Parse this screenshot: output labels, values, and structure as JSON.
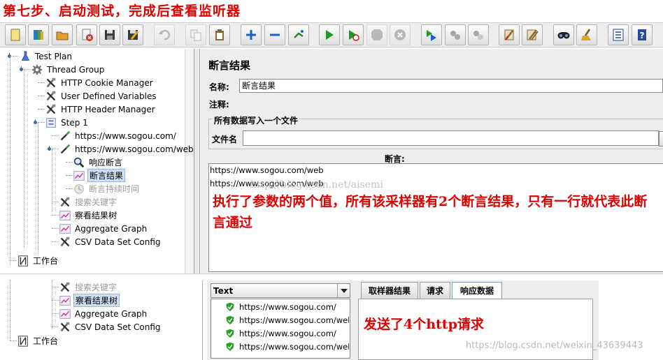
{
  "heading": "第七步、启动测试，完成后查看监听器",
  "toolbar": {
    "buttons": [
      {
        "icon": "new-icon",
        "color": "#f2e28a",
        "enabled": true
      },
      {
        "icon": "templates-icon",
        "color": "#4a9a4a",
        "enabled": true
      },
      {
        "icon": "open-icon",
        "color": "#e0a030",
        "enabled": true
      },
      {
        "icon": "close-plan-icon",
        "color": "#d03030",
        "enabled": true
      },
      {
        "icon": "save-icon",
        "color": "#3a3a3a",
        "enabled": true
      },
      {
        "icon": "save-as-icon",
        "color": "#3a3a3a",
        "enabled": true
      },
      {
        "icon": "undo-icon",
        "color": "#b8b8b8",
        "enabled": false
      },
      {
        "icon": "copy-icon",
        "color": "#b8b8b8",
        "enabled": false
      },
      {
        "icon": "paste-icon",
        "color": "#8a6a30",
        "enabled": true
      },
      {
        "icon": "expand-icon",
        "color": "#1a62c8",
        "enabled": true
      },
      {
        "icon": "collapse-icon",
        "color": "#1a62c8",
        "enabled": true
      },
      {
        "icon": "toggle-icon",
        "color": "#2a8a2a",
        "enabled": true
      },
      {
        "icon": "start-icon",
        "color": "#1f9a2a",
        "enabled": true
      },
      {
        "icon": "start-no-pause-icon",
        "color": "#1f9a2a",
        "enabled": true
      },
      {
        "icon": "stop-icon",
        "color": "#b8b8b8",
        "enabled": false
      },
      {
        "icon": "shutdown-icon",
        "color": "#b8b8b8",
        "enabled": false
      },
      {
        "icon": "remote-start-icon",
        "color": "#1f9a2a",
        "enabled": true
      },
      {
        "icon": "remote-stop-icon",
        "color": "#a8a8a8",
        "enabled": true
      },
      {
        "icon": "remote-shutdown-icon",
        "color": "#a8a8a8",
        "enabled": true
      },
      {
        "icon": "clear-icon",
        "color": "#8a6a30",
        "enabled": true
      },
      {
        "icon": "clear-all-icon",
        "color": "#8a6a30",
        "enabled": true
      },
      {
        "icon": "search-icon",
        "color": "#222222",
        "enabled": true
      },
      {
        "icon": "reset-search-icon",
        "color": "#d8a820",
        "enabled": true
      },
      {
        "icon": "function-helper-icon",
        "color": "#2a4a8a",
        "enabled": true
      },
      {
        "icon": "help-icon",
        "color": "#2a4a9a",
        "enabled": true
      }
    ]
  },
  "tree": {
    "nodes": [
      {
        "label": "Test Plan",
        "icon": "test-plan-icon",
        "selected": false,
        "disabled": false
      },
      {
        "label": "Thread Group",
        "icon": "thread-group-icon",
        "selected": false,
        "disabled": false
      },
      {
        "label": "HTTP Cookie Manager",
        "icon": "config-element-icon",
        "selected": false,
        "disabled": false
      },
      {
        "label": "User Defined Variables",
        "icon": "config-element-icon",
        "selected": false,
        "disabled": false
      },
      {
        "label": "HTTP Header Manager",
        "icon": "config-element-icon",
        "selected": false,
        "disabled": false
      },
      {
        "label": "Step 1",
        "icon": "controller-icon",
        "selected": false,
        "disabled": false
      },
      {
        "label": "https://www.sogou.com/",
        "icon": "sampler-icon",
        "selected": false,
        "disabled": false
      },
      {
        "label": "https://www.sogou.com/web",
        "icon": "sampler-icon",
        "selected": false,
        "disabled": false
      },
      {
        "label": "响应断言",
        "icon": "assertion-icon",
        "selected": false,
        "disabled": false
      },
      {
        "label": "断言结果",
        "icon": "listener-icon",
        "selected": true,
        "disabled": false
      },
      {
        "label": "断言持续时间",
        "icon": "duration-assertion-icon",
        "selected": false,
        "disabled": true
      },
      {
        "label": "搜索关键字",
        "icon": "config-element-icon",
        "selected": false,
        "disabled": true
      },
      {
        "label": "察看结果树",
        "icon": "listener-icon",
        "selected": false,
        "disabled": false
      },
      {
        "label": "Aggregate Graph",
        "icon": "listener-icon",
        "selected": false,
        "disabled": false
      },
      {
        "label": "CSV Data Set Config",
        "icon": "config-element-icon",
        "selected": false,
        "disabled": false
      },
      {
        "label": "工作台",
        "icon": "workbench-icon",
        "selected": false,
        "disabled": false
      }
    ]
  },
  "panel": {
    "title": "断言结果",
    "name_label": "名称:",
    "name_value": "断言结果",
    "comment_label": "注释:",
    "comment_value": "",
    "file_group_title": "所有数据写入一个文件",
    "filename_label": "文件名",
    "filename_value": "",
    "assertions_header": "断言:",
    "assertion_lines": [
      "https://www.sogou.com/web",
      "https://www.sogou.com/web"
    ],
    "watermark": "http://blog.csdn.net/aisemi"
  },
  "annotation1": "执行了参数的两个值，所有该采样器有2个断言结果，只有一行就代表此断言通过",
  "bottom": {
    "tree_nodes": [
      {
        "label": "搜索关键字",
        "icon": "config-element-icon",
        "selected": false,
        "disabled": true
      },
      {
        "label": "察看结果树",
        "icon": "listener-icon",
        "selected": true,
        "disabled": false
      },
      {
        "label": "Aggregate Graph",
        "icon": "listener-icon",
        "selected": false,
        "disabled": false
      },
      {
        "label": "CSV Data Set Config",
        "icon": "config-element-icon",
        "selected": false,
        "disabled": false
      },
      {
        "label": "工作台",
        "icon": "workbench-icon",
        "selected": false,
        "disabled": false
      }
    ],
    "renderer_value": "Text",
    "results": [
      {
        "label": "https://www.sogou.com/",
        "status_icon": "success-shield-icon"
      },
      {
        "label": "https://www.sogou.com/web",
        "status_icon": "success-shield-icon"
      },
      {
        "label": "https://www.sogou.com/",
        "status_icon": "success-shield-icon"
      },
      {
        "label": "https://www.sogou.com/web",
        "status_icon": "success-shield-icon"
      }
    ],
    "tabs": [
      {
        "label": "取样器结果",
        "active": false
      },
      {
        "label": "请求",
        "active": false
      },
      {
        "label": "响应数据",
        "active": true
      }
    ],
    "annotation2": "发送了4个http请求",
    "watermark": "https://blog.csdn.net/weixin_43639443"
  }
}
